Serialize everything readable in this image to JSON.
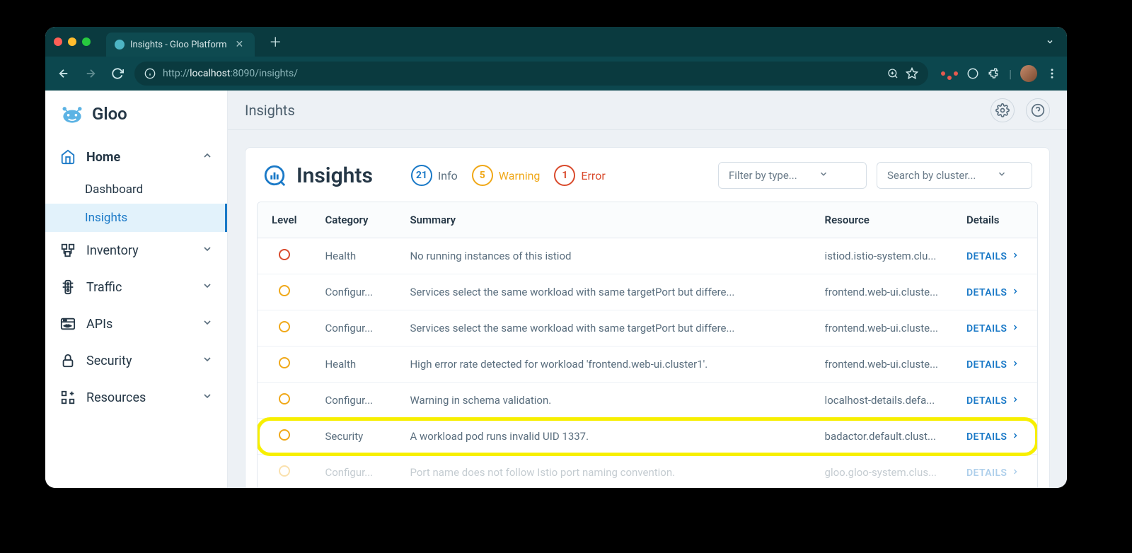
{
  "browser": {
    "tab_title": "Insights - Gloo Platform",
    "url_prefix": "http://",
    "url_host": "localhost",
    "url_port": ":8090",
    "url_path": "/insights/"
  },
  "brand": {
    "name": "Gloo"
  },
  "sidebar": {
    "home": "Home",
    "dashboard": "Dashboard",
    "insights": "Insights",
    "inventory": "Inventory",
    "traffic": "Traffic",
    "apis": "APIs",
    "security": "Security",
    "resources": "Resources"
  },
  "page": {
    "header_title": "Insights",
    "card_title": "Insights",
    "stats": {
      "info_count": "21",
      "info_label": "Info",
      "warn_count": "5",
      "warn_label": "Warning",
      "err_count": "1",
      "err_label": "Error"
    },
    "filter_type_placeholder": "Filter by type...",
    "filter_cluster_placeholder": "Search by cluster..."
  },
  "table": {
    "headers": {
      "level": "Level",
      "category": "Category",
      "summary": "Summary",
      "resource": "Resource",
      "details": "Details"
    },
    "details_label": "DETAILS",
    "rows": [
      {
        "level": "error",
        "category": "Health",
        "summary": "No running instances of this istiod",
        "resource": "istiod.istio-system.clu...",
        "highlight": false
      },
      {
        "level": "warning",
        "category": "Configur...",
        "summary": "Services select the same workload with same targetPort but differe...",
        "resource": "frontend.web-ui.cluste...",
        "highlight": false
      },
      {
        "level": "warning",
        "category": "Configur...",
        "summary": "Services select the same workload with same targetPort but differe...",
        "resource": "frontend.web-ui.cluste...",
        "highlight": false
      },
      {
        "level": "warning",
        "category": "Health",
        "summary": "High error rate detected for workload 'frontend.web-ui.cluster1'.",
        "resource": "frontend.web-ui.cluste...",
        "highlight": false
      },
      {
        "level": "warning",
        "category": "Configur...",
        "summary": "Warning in schema validation.",
        "resource": "localhost-details.defa...",
        "highlight": false
      },
      {
        "level": "warning",
        "category": "Security",
        "summary": "A workload pod runs invalid UID 1337.",
        "resource": "badactor.default.clust...",
        "highlight": true
      },
      {
        "level": "warning",
        "category": "Configur...",
        "summary": "Port name does not follow Istio port naming convention.",
        "resource": "gloo.gloo-system.clus...",
        "highlight": false,
        "fade": true
      }
    ]
  }
}
